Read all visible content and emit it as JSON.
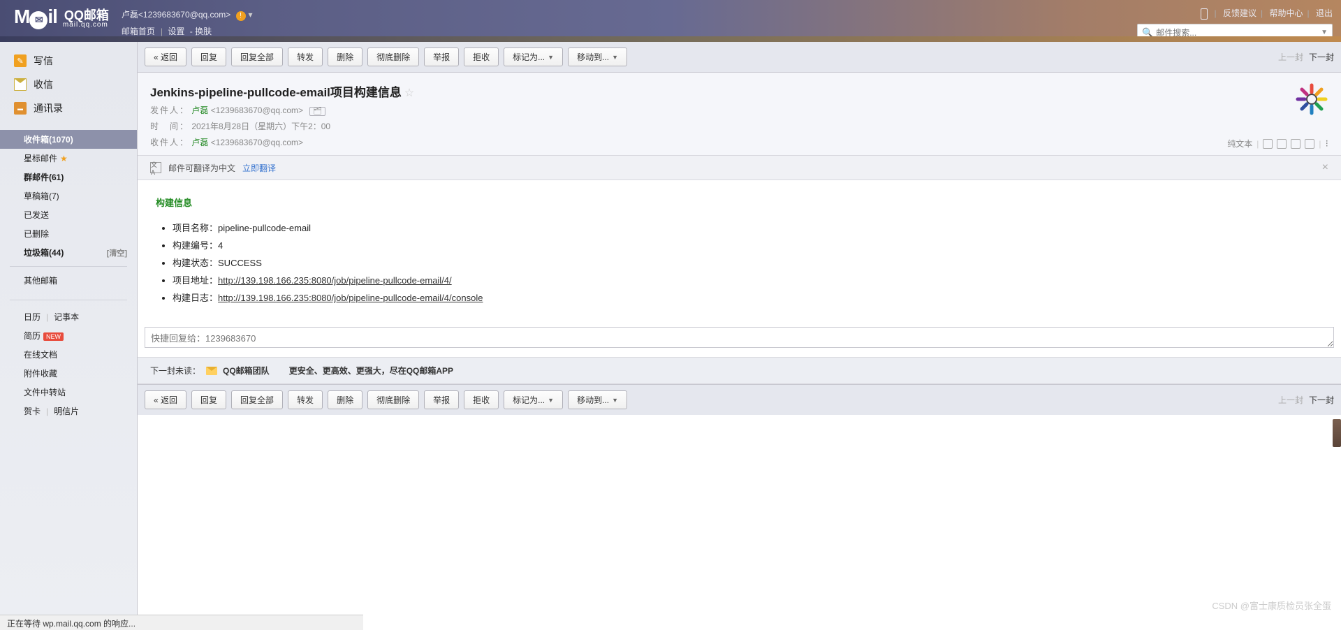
{
  "header": {
    "logo_main": "M",
    "logo_ail": "il",
    "logo_qq": "QQ邮箱",
    "logo_sub": "mail.qq.com",
    "user_display": "卢磊<1239683670@qq.com>",
    "nav": {
      "home": "邮箱首页",
      "settings": "设置",
      "skin": "换肤"
    },
    "right": {
      "feedback": "反馈建议",
      "help": "帮助中心",
      "logout": "退出"
    },
    "search_placeholder": "邮件搜索..."
  },
  "sidebar": {
    "primary": {
      "compose": "写信",
      "receive": "收信",
      "contacts": "通讯录"
    },
    "folders": {
      "inbox": "收件箱(1070)",
      "star": "星标邮件",
      "group": "群邮件(61)",
      "draft": "草稿箱(7)",
      "sent": "已发送",
      "deleted": "已删除",
      "trash": "垃圾箱(44)",
      "trash_clear": "[清空]",
      "other": "其他邮箱"
    },
    "links": {
      "calendar": "日历",
      "notes": "记事本",
      "resume": "简历",
      "resume_badge": "NEW",
      "docs": "在线文档",
      "attach": "附件收藏",
      "transfer": "文件中转站",
      "cards": "贺卡",
      "postcard": "明信片"
    }
  },
  "toolbar": {
    "back": "« 返回",
    "reply": "回复",
    "reply_all": "回复全部",
    "forward": "转发",
    "delete": "删除",
    "perm_delete": "彻底删除",
    "report": "举报",
    "reject": "拒收",
    "mark": "标记为...",
    "move": "移动到...",
    "prev": "上一封",
    "next": "下一封"
  },
  "mail": {
    "subject": "Jenkins-pipeline-pullcode-email项目构建信息",
    "from_label": "发件人：",
    "from_name": "卢磊",
    "from_addr": "<1239683670@qq.com>",
    "time_label": "时　间：",
    "time_value": "2021年8月28日（星期六）下午2：00",
    "to_label": "收件人：",
    "to_name": "卢磊",
    "to_addr": "<1239683670@qq.com>",
    "plaintext": "纯文本",
    "translate_text": "邮件可翻译为中文",
    "translate_link": "立即翻译"
  },
  "body": {
    "heading": "构建信息",
    "items": [
      {
        "label": "项目名称：",
        "value": "pipeline-pullcode-email"
      },
      {
        "label": "构建编号：",
        "value": "4"
      },
      {
        "label": "构建状态：",
        "value": "SUCCESS"
      },
      {
        "label": "项目地址：",
        "link": "http://139.198.166.235:8080/job/pipeline-pullcode-email/4/"
      },
      {
        "label": "构建日志：",
        "link": "http://139.198.166.235:8080/job/pipeline-pullcode-email/4/console"
      }
    ]
  },
  "quickreply_placeholder": "快捷回复给：1239683670",
  "nextbar": {
    "label": "下一封未读：",
    "team": "QQ邮箱团队",
    "slogan": "更安全、更高效、更强大，尽在QQ邮箱APP"
  },
  "status": "正在等待 wp.mail.qq.com 的响应...",
  "watermark": "CSDN @富士康质检员张全蛋"
}
